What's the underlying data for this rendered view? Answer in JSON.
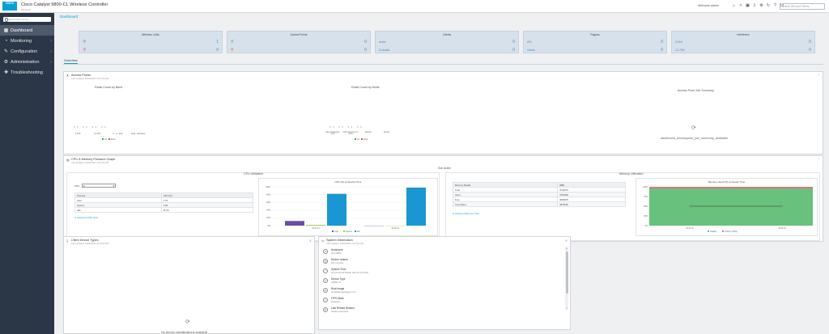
{
  "app": {
    "logo": "CISCO",
    "title": "Cisco Catalyst 9800-CL Wireless Controller",
    "version": "16.12.1s",
    "welcome": "Welcome admin",
    "search_placeholder": "Search APs and Clients"
  },
  "sidebar": {
    "search_placeholder": "Search Menu Items",
    "items": [
      {
        "label": "Dashboard",
        "icon": "dashboard-icon"
      },
      {
        "label": "Monitoring",
        "icon": "monitoring-icon"
      },
      {
        "label": "Configuration",
        "icon": "configuration-icon"
      },
      {
        "label": "Administration",
        "icon": "administration-icon"
      },
      {
        "label": "Troubleshooting",
        "icon": "troubleshooting-icon"
      }
    ]
  },
  "breadcrumb": "Dashboard",
  "tiles": [
    {
      "title": "Wireless LANs",
      "rows": [
        {
          "label": "",
          "value": "1"
        },
        {
          "label": "",
          "value": "0"
        }
      ]
    },
    {
      "title": "Access Points",
      "rows": [
        {
          "label": "",
          "value": "0"
        },
        {
          "label": "",
          "value": "0"
        }
      ]
    },
    {
      "title": "Clients",
      "rows": [
        {
          "label": "Active",
          "value": "0"
        },
        {
          "label": "Excluded",
          "value": "0"
        }
      ]
    },
    {
      "title": "Rogues",
      "rows": [
        {
          "label": "APs",
          "value": "0"
        },
        {
          "label": "Clients",
          "value": "0"
        }
      ]
    },
    {
      "title": "Interferers",
      "rows": [
        {
          "label": "5 GHz",
          "value": "0"
        },
        {
          "label": "2.4 GHz",
          "value": "0"
        }
      ]
    }
  ],
  "tab": "Overview",
  "access_points": {
    "title": "Access Points",
    "updated": "Last Updated: 10/24/2020, 10:21:04 AM",
    "radio_band": {
      "title": "Radio Count by Band",
      "values": [
        "0",
        "0",
        "0",
        "0",
        "0",
        "0",
        "0",
        "0"
      ],
      "ticks": [
        "6 GHz",
        "2.4 GHz",
        "rx - rx - dual",
        "band - dual band"
      ],
      "legend": [
        "Up",
        "Down"
      ]
    },
    "radio_mode": {
      "title": "Radio Count by Mode",
      "values": [
        "0",
        "0",
        "0",
        "0",
        "0",
        "0",
        "0",
        "0"
      ],
      "ticks": [
        "Client Serving (6 GHz)",
        "Client Serving (2.4 GHz)",
        "Monitor",
        "Sensor"
      ],
      "legend": [
        "Up",
        "Down"
      ]
    },
    "join": {
      "title": "Access Point Join Summary",
      "nodata": "dashboard_accesspoint_join_summary_available"
    }
  },
  "cpu_mem": {
    "title": "CPU & Memory Pressure Graph",
    "updated": "Last Updated: 10/24/2020, 10:21:04 AM",
    "slot": "Slot: Active",
    "cpu": {
      "title": "CPU Utilization",
      "cpu_label": "CPU",
      "cpu_value": "0",
      "headers": [
        "Process",
        "CPU (%)"
      ],
      "rows": [
        [
          "User",
          "1.75"
        ],
        [
          "System",
          "0.56"
        ],
        [
          "Idle",
          "97.44"
        ]
      ],
      "link": "Advanced CPU View"
    },
    "mem": {
      "title": "Memory Utilization",
      "headers": [
        "Memory Details",
        "(MB)"
      ],
      "rows": [
        [
          "Total",
          "3744972"
        ],
        [
          "Used",
          "3764560"
        ],
        [
          "Free",
          "4090676"
        ],
        [
          "Committed",
          "4675020"
        ]
      ],
      "link": "Advanced Memory View"
    }
  },
  "client_types": {
    "title": "Client Device Types",
    "updated": "Last Updated: 10/24/2020, 10:21:04 AM",
    "nodata": "No device classifications available"
  },
  "sysinfo": {
    "title": "System Information",
    "updated": "Last Updated: 10/24/2020, 10:21:04 AM",
    "rows": [
      {
        "label": "Hostname",
        "value": "WLC9800"
      },
      {
        "label": "Device Uptime",
        "value": "101 minutes"
      },
      {
        "label": "System Time",
        "value": "10:21:14.010 Britain Sat Oct 24 2020"
      },
      {
        "label": "Device Type",
        "value": "C9800-CL"
      },
      {
        "label": "Boot Image",
        "value": "bootflash:packages.conf"
      },
      {
        "label": "FIPS Mode",
        "value": "Disabled"
      },
      {
        "label": "Last Reload Reason",
        "value": "reload requested"
      }
    ]
  },
  "chart_data": [
    {
      "type": "bar",
      "title": "CPU (%) vs Device Time",
      "categories": [
        "10:21:14",
        "10:21:44"
      ],
      "series": [
        {
          "name": "User",
          "values": [
            12,
            0
          ]
        },
        {
          "name": "System",
          "values": [
            2,
            0
          ]
        },
        {
          "name": "Idle",
          "values": [
            82,
            98
          ]
        }
      ],
      "ylim": [
        0,
        100
      ],
      "yticks": [
        "0%",
        "20%",
        "40%",
        "60%",
        "80%",
        "100%"
      ],
      "colors": [
        "#6b4f9e",
        "#a7c957",
        "#1a96d3"
      ]
    },
    {
      "type": "area",
      "title": "Memory Used (%) vs Device Time",
      "x": [
        "10:21:14",
        "10:21:44"
      ],
      "series": [
        {
          "name": "Healthy",
          "values": [
            96,
            96
          ]
        },
        {
          "name": "Critical (>95%)",
          "values": [
            100,
            100
          ]
        }
      ],
      "ylim": [
        0,
        100
      ],
      "yticks": [
        "0%",
        "25%",
        "50%",
        "75%",
        "100%"
      ],
      "colors": [
        "#68c17c",
        "#e8717b"
      ]
    }
  ],
  "colors": {
    "accent": "#049fd9",
    "sidebar": "#2b3746",
    "tile": "#d7e1ec"
  }
}
